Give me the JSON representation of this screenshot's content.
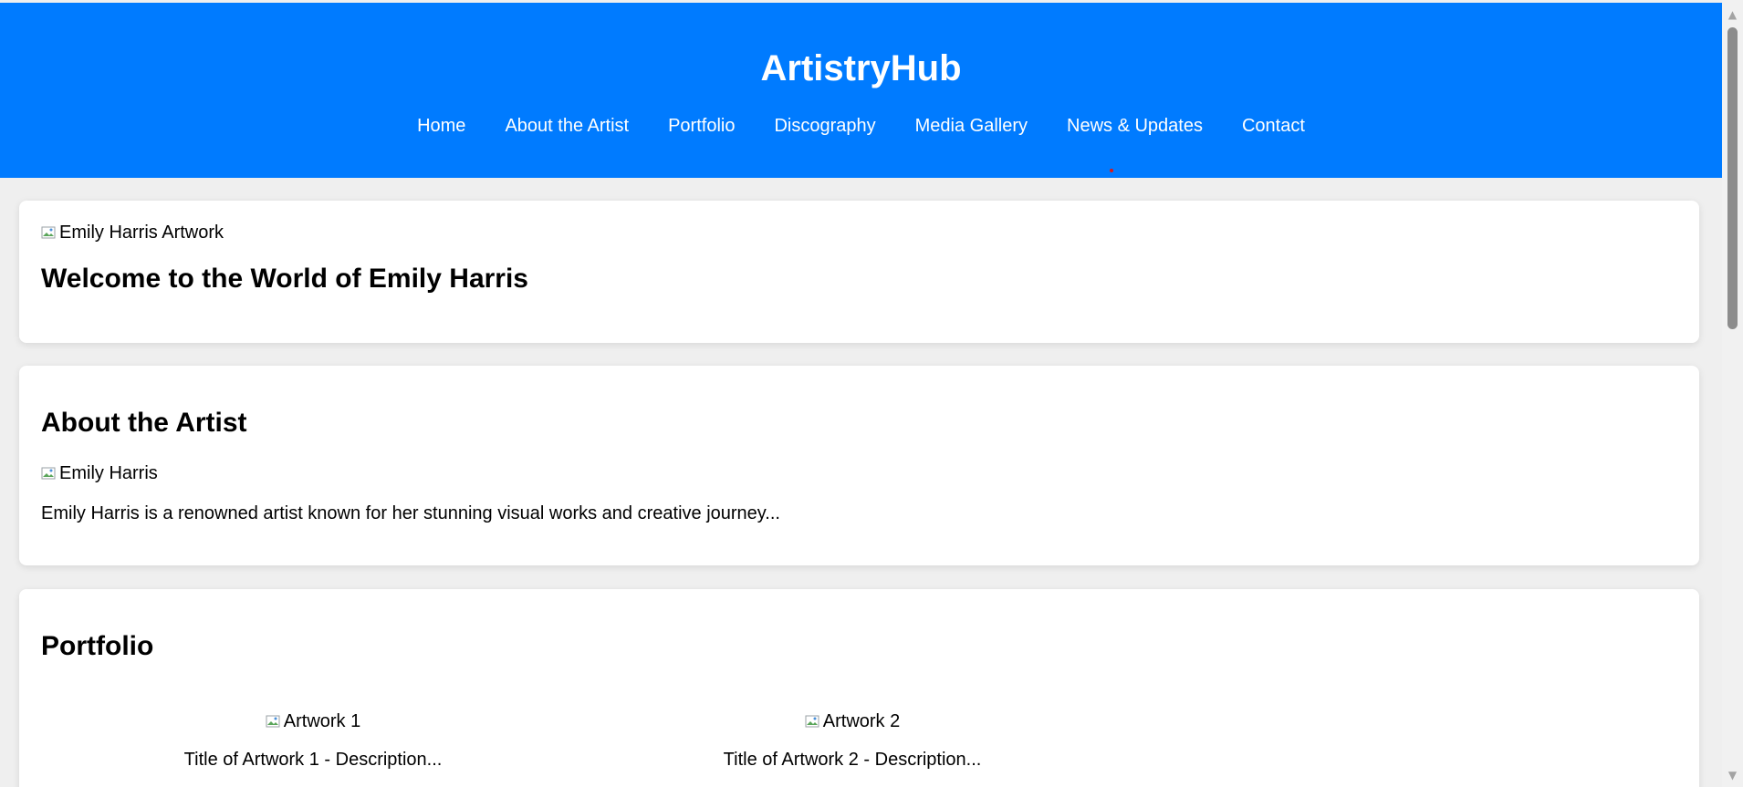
{
  "header": {
    "title": "ArtistryHub",
    "nav": [
      {
        "label": "Home"
      },
      {
        "label": "About the Artist"
      },
      {
        "label": "Portfolio"
      },
      {
        "label": "Discography"
      },
      {
        "label": "Media Gallery"
      },
      {
        "label": "News & Updates"
      },
      {
        "label": "Contact"
      }
    ]
  },
  "hero": {
    "image_alt": "Emily Harris Artwork",
    "title": "Welcome to the World of Emily Harris"
  },
  "about": {
    "title": "About the Artist",
    "image_alt": "Emily Harris",
    "text": "Emily Harris is a renowned artist known for her stunning visual works and creative journey..."
  },
  "portfolio": {
    "title": "Portfolio",
    "items": [
      {
        "image_alt": "Artwork 1",
        "caption": "Title of Artwork 1 - Description..."
      },
      {
        "image_alt": "Artwork 2",
        "caption": "Title of Artwork 2 - Description..."
      }
    ]
  },
  "colors": {
    "header_bg": "#007bff",
    "page_bg": "#efefef",
    "card_bg": "#ffffff"
  },
  "icons": {
    "broken_image": "broken-image-icon",
    "scroll_up": "scroll-up-arrow-icon",
    "scroll_down": "scroll-down-arrow-icon"
  }
}
